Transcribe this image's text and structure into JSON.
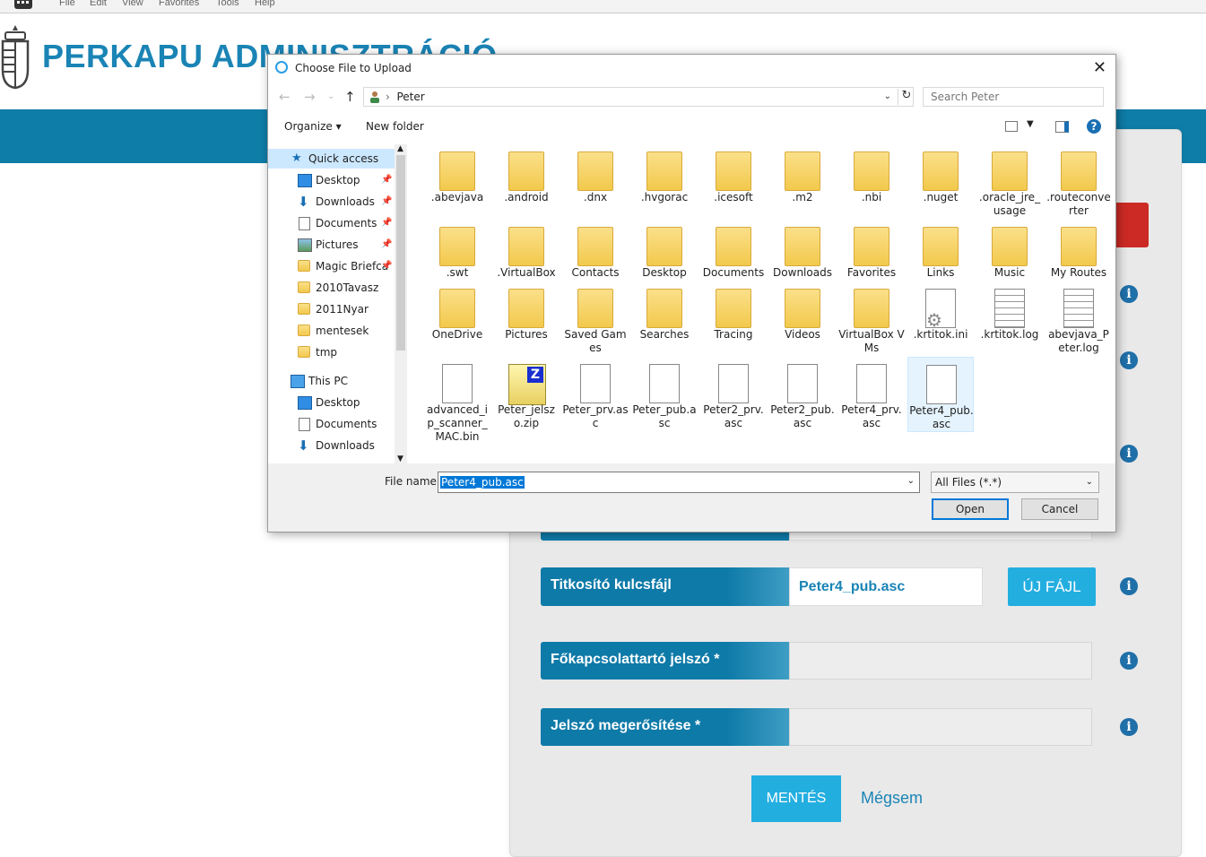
{
  "browser_menu": [
    "File",
    "Edit",
    "View",
    "Favorites",
    "Tools",
    "Help"
  ],
  "page": {
    "title": "PERKAPU ADMINISZTRÁCIÓ",
    "form": {
      "key_file_label": "Titkosító kulcsfájl",
      "key_file_value": "Peter4_pub.asc",
      "new_file_button": "ÚJ FÁJL",
      "master_password_label": "Főkapcsolattartó jelszó *",
      "confirm_password_label": "Jelszó megerősítése *",
      "save_button": "MENTÉS",
      "cancel_link": "Mégsem"
    },
    "colors": {
      "accent": "#0e7aa8",
      "button": "#23aee0",
      "danger": "#cc2a24"
    }
  },
  "dialog": {
    "title": "Choose File to Upload",
    "breadcrumb": "Peter",
    "search_placeholder": "Search Peter",
    "organize": "Organize",
    "new_folder": "New folder",
    "nav": [
      {
        "label": "Quick access",
        "icon": "star-icon",
        "pinned": false
      },
      {
        "label": "Desktop",
        "icon": "desktop-icon",
        "pinned": true
      },
      {
        "label": "Downloads",
        "icon": "download-icon",
        "pinned": true
      },
      {
        "label": "Documents",
        "icon": "documents-icon",
        "pinned": true
      },
      {
        "label": "Pictures",
        "icon": "pictures-icon",
        "pinned": true
      },
      {
        "label": "Magic Briefca",
        "icon": "folder-icon",
        "pinned": true
      },
      {
        "label": "2010Tavasz",
        "icon": "folder-icon",
        "pinned": false
      },
      {
        "label": "2011Nyar",
        "icon": "folder-icon",
        "pinned": false
      },
      {
        "label": "mentesek",
        "icon": "folder-icon",
        "pinned": false
      },
      {
        "label": "tmp",
        "icon": "folder-icon",
        "pinned": false
      },
      {
        "label": "This PC",
        "icon": "computer-icon",
        "pinned": false
      },
      {
        "label": "Desktop",
        "icon": "desktop-icon",
        "pinned": false
      },
      {
        "label": "Documents",
        "icon": "documents-icon",
        "pinned": false
      },
      {
        "label": "Downloads",
        "icon": "download-icon",
        "pinned": false
      }
    ],
    "files": [
      {
        "name": ".abevjava",
        "type": "folder"
      },
      {
        "name": ".android",
        "type": "folder"
      },
      {
        "name": ".dnx",
        "type": "folder"
      },
      {
        "name": ".hvgorac",
        "type": "folder"
      },
      {
        "name": ".icesoft",
        "type": "folder"
      },
      {
        "name": ".m2",
        "type": "folder"
      },
      {
        "name": ".nbi",
        "type": "folder"
      },
      {
        "name": ".nuget",
        "type": "folder"
      },
      {
        "name": ".oracle_jre_usage",
        "type": "folder"
      },
      {
        "name": ".routeconverter",
        "type": "folder"
      },
      {
        "name": ".swt",
        "type": "folder"
      },
      {
        "name": ".VirtualBox",
        "type": "folder"
      },
      {
        "name": "Contacts",
        "type": "folder"
      },
      {
        "name": "Desktop",
        "type": "folder"
      },
      {
        "name": "Documents",
        "type": "folder"
      },
      {
        "name": "Downloads",
        "type": "folder"
      },
      {
        "name": "Favorites",
        "type": "folder"
      },
      {
        "name": "Links",
        "type": "folder"
      },
      {
        "name": "Music",
        "type": "folder"
      },
      {
        "name": "My Routes",
        "type": "folder"
      },
      {
        "name": "OneDrive",
        "type": "folder"
      },
      {
        "name": "Pictures",
        "type": "folder"
      },
      {
        "name": "Saved Games",
        "type": "folder"
      },
      {
        "name": "Searches",
        "type": "folder"
      },
      {
        "name": "Tracing",
        "type": "folder"
      },
      {
        "name": "Videos",
        "type": "folder"
      },
      {
        "name": "VirtualBox VMs",
        "type": "folder"
      },
      {
        "name": ".krtitok.ini",
        "type": "settings-file"
      },
      {
        "name": ".krtitok.log",
        "type": "text-file"
      },
      {
        "name": "abevjava_Peter.log",
        "type": "text-file"
      },
      {
        "name": "advanced_ip_scanner_MAC.bin",
        "type": "file"
      },
      {
        "name": "Peter_jelszo.zip",
        "type": "zip-file"
      },
      {
        "name": "Peter_prv.asc",
        "type": "file"
      },
      {
        "name": "Peter_pub.asc",
        "type": "file"
      },
      {
        "name": "Peter2_prv.asc",
        "type": "file"
      },
      {
        "name": "Peter2_pub.asc",
        "type": "file"
      },
      {
        "name": "Peter4_prv.asc",
        "type": "file"
      },
      {
        "name": "Peter4_pub.asc",
        "type": "file",
        "selected": true
      }
    ],
    "file_name_label": "File name:",
    "file_name_value": "Peter4_pub.asc",
    "file_type": "All Files (*.*)",
    "open_button": "Open",
    "cancel_button": "Cancel"
  }
}
